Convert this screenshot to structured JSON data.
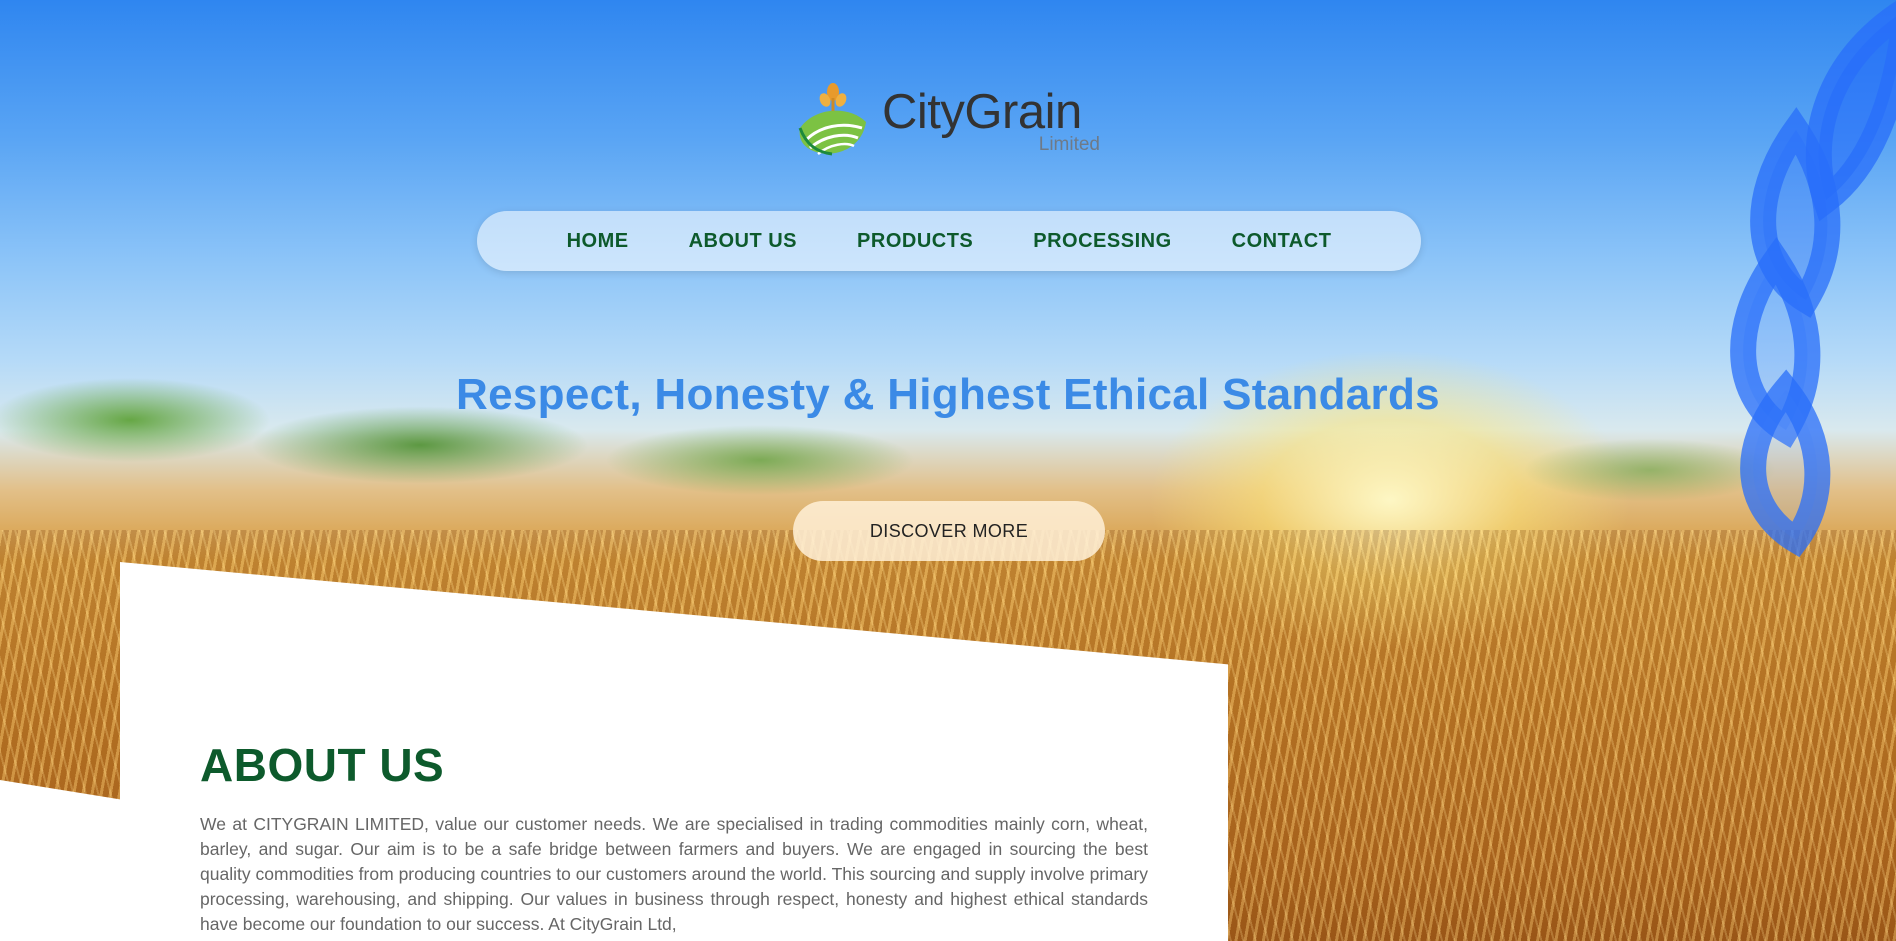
{
  "brand": {
    "name": "CityGrain",
    "subtitle": "Limited"
  },
  "nav": {
    "items": [
      {
        "label": "HOME"
      },
      {
        "label": "ABOUT US"
      },
      {
        "label": "PRODUCTS"
      },
      {
        "label": "PROCESSING"
      },
      {
        "label": "CONTACT"
      }
    ]
  },
  "hero": {
    "headline": "Respect, Honesty & Highest Ethical Standards",
    "cta_label": "DISCOVER MORE"
  },
  "about": {
    "title": "ABOUT US",
    "body": "We at CITYGRAIN LIMITED, value our customer needs. We are specialised in trading commodities mainly corn, wheat, barley, and sugar. Our aim is to be a safe bridge between farmers and buyers. We are engaged in sourcing the best quality commodities from producing countries to our customers around the world. This sourcing and supply involve primary processing, warehousing, and shipping. Our values in business through respect, honesty and highest ethical standards have become our foundation to our success. At CityGrain Ltd,"
  },
  "colors": {
    "brand_green": "#0d5a2c",
    "headline_blue": "#3b8ae6",
    "sky": "#2f86f0",
    "wheat": "#c8832b"
  },
  "icons": {
    "logo": "wheat-field-logo-icon",
    "watermark": "wheat-watermark-icon"
  }
}
